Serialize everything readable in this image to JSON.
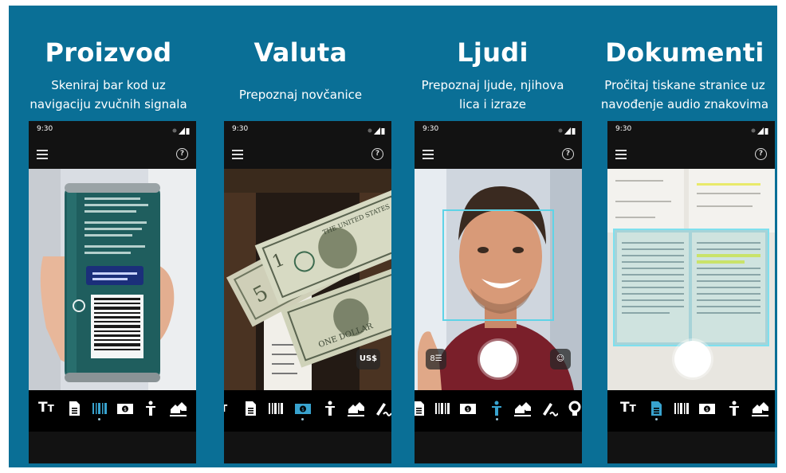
{
  "panels": [
    {
      "title": "Proizvod",
      "subtitle_l1": "Skeniraj bar kod  uz",
      "subtitle_l2": "navigaciju zvučnih signala",
      "time": "9:30"
    },
    {
      "title": "Valuta",
      "subtitle_l1": "Prepoznaj novčanice",
      "subtitle_l2": "",
      "time": "9:30",
      "currency_badge": "US$"
    },
    {
      "title": "Ljudi",
      "subtitle_l1": "Prepoznaj ljude, njihova",
      "subtitle_l2": "lica i izraze",
      "time": "9:30"
    },
    {
      "title": "Dokumenti",
      "subtitle_l1": "Pročitaj tiskane stranice uz",
      "subtitle_l2": "navođenje audio znakovima",
      "time": "9:30"
    }
  ],
  "text_tab_label": "T",
  "text_tab_label_small": "T",
  "colors": {
    "background": "#0a6f96",
    "active_tab": "#38a3cf",
    "face_box": "#5fd3e6"
  },
  "icons": [
    "menu-icon",
    "help-icon",
    "text-icon",
    "document-icon",
    "barcode-icon",
    "currency-icon",
    "person-icon",
    "scene-icon",
    "handwriting-icon"
  ]
}
